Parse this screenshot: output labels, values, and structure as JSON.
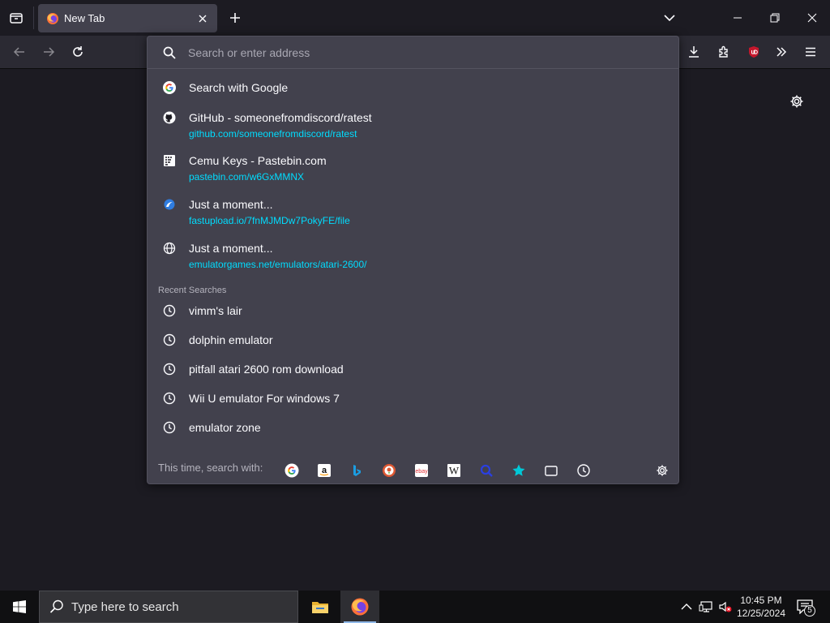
{
  "tab": {
    "title": "New Tab"
  },
  "urlbar": {
    "placeholder": "Search or enter address",
    "results": [
      {
        "title": "Search with Google",
        "url": "",
        "icon": "google-icon"
      },
      {
        "title": "GitHub - someonefromdiscord/ratest",
        "url": "github.com/someonefromdiscord/ratest",
        "icon": "github-icon"
      },
      {
        "title": "Cemu Keys - Pastebin.com",
        "url": "pastebin.com/w6GxMMNX",
        "icon": "pastebin-icon"
      },
      {
        "title": "Just a moment...",
        "url": "fastupload.io/7fnMJMDw7PokyFE/file",
        "icon": "fastupload-icon"
      },
      {
        "title": "Just a moment...",
        "url": "emulatorgames.net/emulators/atari-2600/",
        "icon": "globe-icon"
      }
    ],
    "recent_heading": "Recent Searches",
    "recent": [
      {
        "text": "vimm's lair"
      },
      {
        "text": "dolphin emulator"
      },
      {
        "text": "pitfall atari 2600 rom download"
      },
      {
        "text": "Wii U emulator For windows 7"
      },
      {
        "text": "emulator zone"
      }
    ],
    "oneoff_label": "This time, search with:",
    "engines": [
      "google",
      "amazon",
      "bing",
      "duckduckgo",
      "ebay",
      "wikipedia",
      "search",
      "bookmarks",
      "tabs",
      "history"
    ]
  },
  "taskbar": {
    "search_placeholder": "Type here to search",
    "time": "10:45 PM",
    "date": "12/25/2024",
    "notification_count": "5"
  },
  "colors": {
    "url_text": "#00ddff",
    "panel": "#42414d",
    "toolbar": "#2b2a33",
    "tab_bg": "#1c1b22"
  }
}
